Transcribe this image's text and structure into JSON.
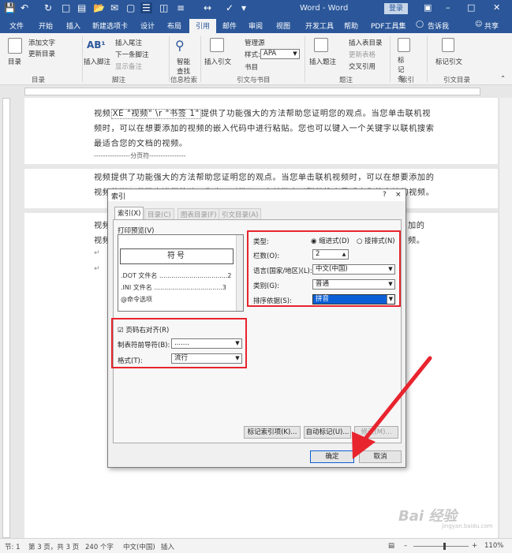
{
  "titlebar": {
    "title": "Word - Word",
    "login": "登录",
    "quick_icons": [
      "save-icon",
      "undo-icon",
      "redo-icon",
      "new-doc-icon",
      "open-icon",
      "print-preview-icon"
    ]
  },
  "tabs": [
    "文件",
    "开始",
    "插入",
    "新建选项卡",
    "设计",
    "布局",
    "引用",
    "邮件",
    "审阅",
    "视图",
    "开发工具",
    "帮助",
    "PDF工具集",
    "告诉我",
    "共享"
  ],
  "ribbon": {
    "toc": "目录",
    "add_text": "添加文字",
    "update_toc": "更新目录",
    "group_toc": "目录",
    "insert_footnote": "插入脚注",
    "insert_endnote": "插入尾注",
    "next_footnote": "下一条脚注",
    "show_notes": "显示备注",
    "group_footnote": "脚注",
    "smart_lookup": "智能查找",
    "group_research": "信息检索",
    "insert_citation": "插入引文",
    "manage_sources": "管理源",
    "style_label": "样式:",
    "style_value": "APA",
    "bibliography": "书目",
    "group_citation": "引文与书目",
    "insert_caption": "插入题注",
    "insert_tof": "插入表目录",
    "update_table": "更新表格",
    "cross_reference": "交叉引用",
    "group_caption": "题注",
    "mark_entry": "标记条目",
    "group_index": "索引",
    "mark_citation": "标记引文",
    "group_toa": "引文目录"
  },
  "document": {
    "field_code": "XE \"视频\" \\r \"书签 1\"",
    "p1_line1_prefix": "视频",
    "p1_line1_suffix": "提供了功能强大的方法帮助您证明您的观点。当您单击联机视",
    "p1_line2": "频时，可以在想要添加的视频的嵌入代码中进行粘贴。您也可以键入一个关键字以联机搜索",
    "p1_line3": "最适合您的文档的视频。",
    "page_break": "分页符",
    "p2_line1": "视频提供了功能强大的方法帮助您证明您的观点。当您单击联机视频时，可以在想要添加的",
    "p2_line2": "视频的嵌入代码中进行粘贴。您也可以键入一个关键字以联机搜索最适合您的文档的视频。",
    "p3_line1_a": "视频",
    "p3_line1_b": "加的",
    "p3_line2_a": "视频",
    "p3_line2_b": "频。"
  },
  "dialog": {
    "title": "索引",
    "help": "?",
    "close": "×",
    "tabs": [
      "索引(X)",
      "目录(C)",
      "图表目录(F)",
      "引文目录(A)"
    ],
    "print_preview_label": "打印预览(V)",
    "preview_symbol": "符号",
    "preview_lines": [
      ".DOT 文件名 ..................................2",
      ".INI 文件名 ..................................3",
      "@命令选项"
    ],
    "type_label": "类型:",
    "type_indent": "缩进式(D)",
    "type_runin": "接排式(N)",
    "columns_label": "栏数(O):",
    "columns_value": "2",
    "language_label": "语言(国家/地区)(L):",
    "language_value": "中文(中国)",
    "category_label": "类别(G):",
    "category_value": "普通",
    "sort_label": "排序依据(S):",
    "sort_value": "拼音",
    "right_align_label": "页码右对齐(R)",
    "leader_label": "制表符前导符(B):",
    "leader_value": ".......",
    "format_label": "格式(T):",
    "format_value": "流行",
    "mark_entry_btn": "标记索引项(K)...",
    "automark_btn": "自动标记(U)...",
    "modify_btn": "修改(M)...",
    "ok_btn": "确定",
    "cancel_btn": "取消"
  },
  "statusbar": {
    "section": "节: 1",
    "page": "第 3 页，共 3 页",
    "words": "240 个字",
    "language": "中文(中国)",
    "mode": "插入",
    "zoom": "110%"
  },
  "watermark": {
    "brand": "Bai 经验",
    "url": "jingyan.baidu.com"
  },
  "colors": {
    "word_blue": "#2b579a",
    "annotation_red": "#e8242e",
    "selection_blue": "#0b5fd6"
  }
}
